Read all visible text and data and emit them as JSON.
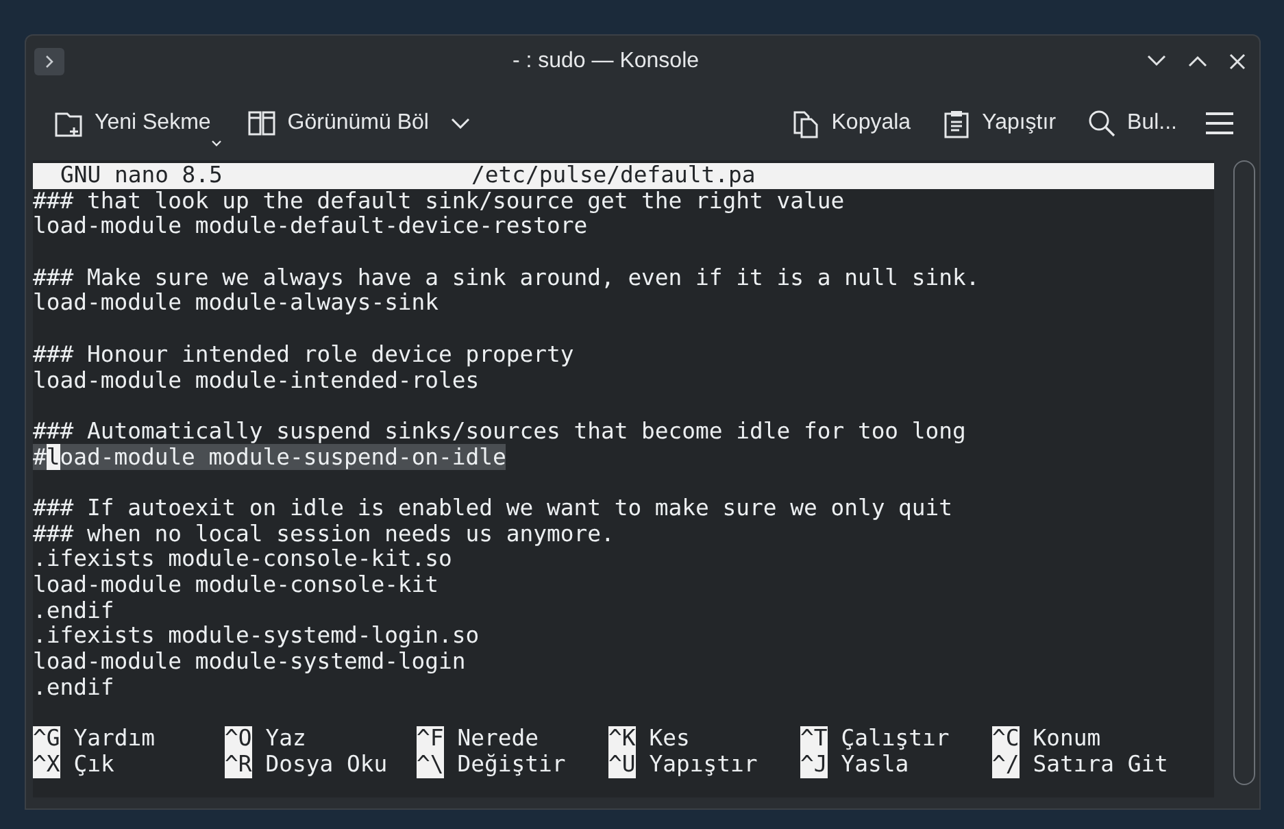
{
  "window": {
    "title": "- : sudo — Konsole"
  },
  "toolbar": {
    "left": [
      {
        "kind": "new-tab",
        "label": "Yeni Sekme"
      },
      {
        "kind": "split",
        "label": "Görünümü Böl"
      }
    ],
    "right": [
      {
        "kind": "copy",
        "label": "Kopyala"
      },
      {
        "kind": "paste",
        "label": "Yapıştır"
      },
      {
        "kind": "find",
        "label": "Bul..."
      }
    ]
  },
  "editor": {
    "app": "GNU nano 8.5",
    "file": "/etc/pulse/default.pa",
    "lines": [
      {
        "kind": "text",
        "text": "### that look up the default sink/source get the right value"
      },
      {
        "kind": "text",
        "text": "load-module module-default-device-restore"
      },
      {
        "kind": "blank"
      },
      {
        "kind": "text",
        "text": "### Make sure we always have a sink around, even if it is a null sink."
      },
      {
        "kind": "text",
        "text": "load-module module-always-sink"
      },
      {
        "kind": "blank"
      },
      {
        "kind": "text",
        "text": "### Honour intended role device property"
      },
      {
        "kind": "text",
        "text": "load-module module-intended-roles"
      },
      {
        "kind": "blank"
      },
      {
        "kind": "text",
        "text": "### Automatically suspend sinks/sources that become idle for too long"
      },
      {
        "kind": "cursor",
        "before": "#",
        "cursor": "l",
        "after": "oad-module module-suspend-on-idle"
      },
      {
        "kind": "blank"
      },
      {
        "kind": "text",
        "text": "### If autoexit on idle is enabled we want to make sure we only quit"
      },
      {
        "kind": "text",
        "text": "### when no local session needs us anymore."
      },
      {
        "kind": "text",
        "text": ".ifexists module-console-kit.so"
      },
      {
        "kind": "text",
        "text": "load-module module-console-kit"
      },
      {
        "kind": "text",
        "text": ".endif"
      },
      {
        "kind": "text",
        "text": ".ifexists module-systemd-login.so"
      },
      {
        "kind": "text",
        "text": "load-module module-systemd-login"
      },
      {
        "kind": "text",
        "text": ".endif"
      }
    ],
    "shortcuts": [
      [
        {
          "key": "^G",
          "label": "Yardım"
        },
        {
          "key": "^O",
          "label": "Yaz"
        },
        {
          "key": "^F",
          "label": "Nerede"
        },
        {
          "key": "^K",
          "label": "Kes"
        },
        {
          "key": "^T",
          "label": "Çalıştır"
        },
        {
          "key": "^C",
          "label": "Konum"
        }
      ],
      [
        {
          "key": "^X",
          "label": "Çık"
        },
        {
          "key": "^R",
          "label": "Dosya Oku"
        },
        {
          "key": "^\\",
          "label": "Değiştir"
        },
        {
          "key": "^U",
          "label": "Yapıştır"
        },
        {
          "key": "^J",
          "label": "Yasla"
        },
        {
          "key": "^/",
          "label": "Satıra Git"
        }
      ]
    ]
  }
}
